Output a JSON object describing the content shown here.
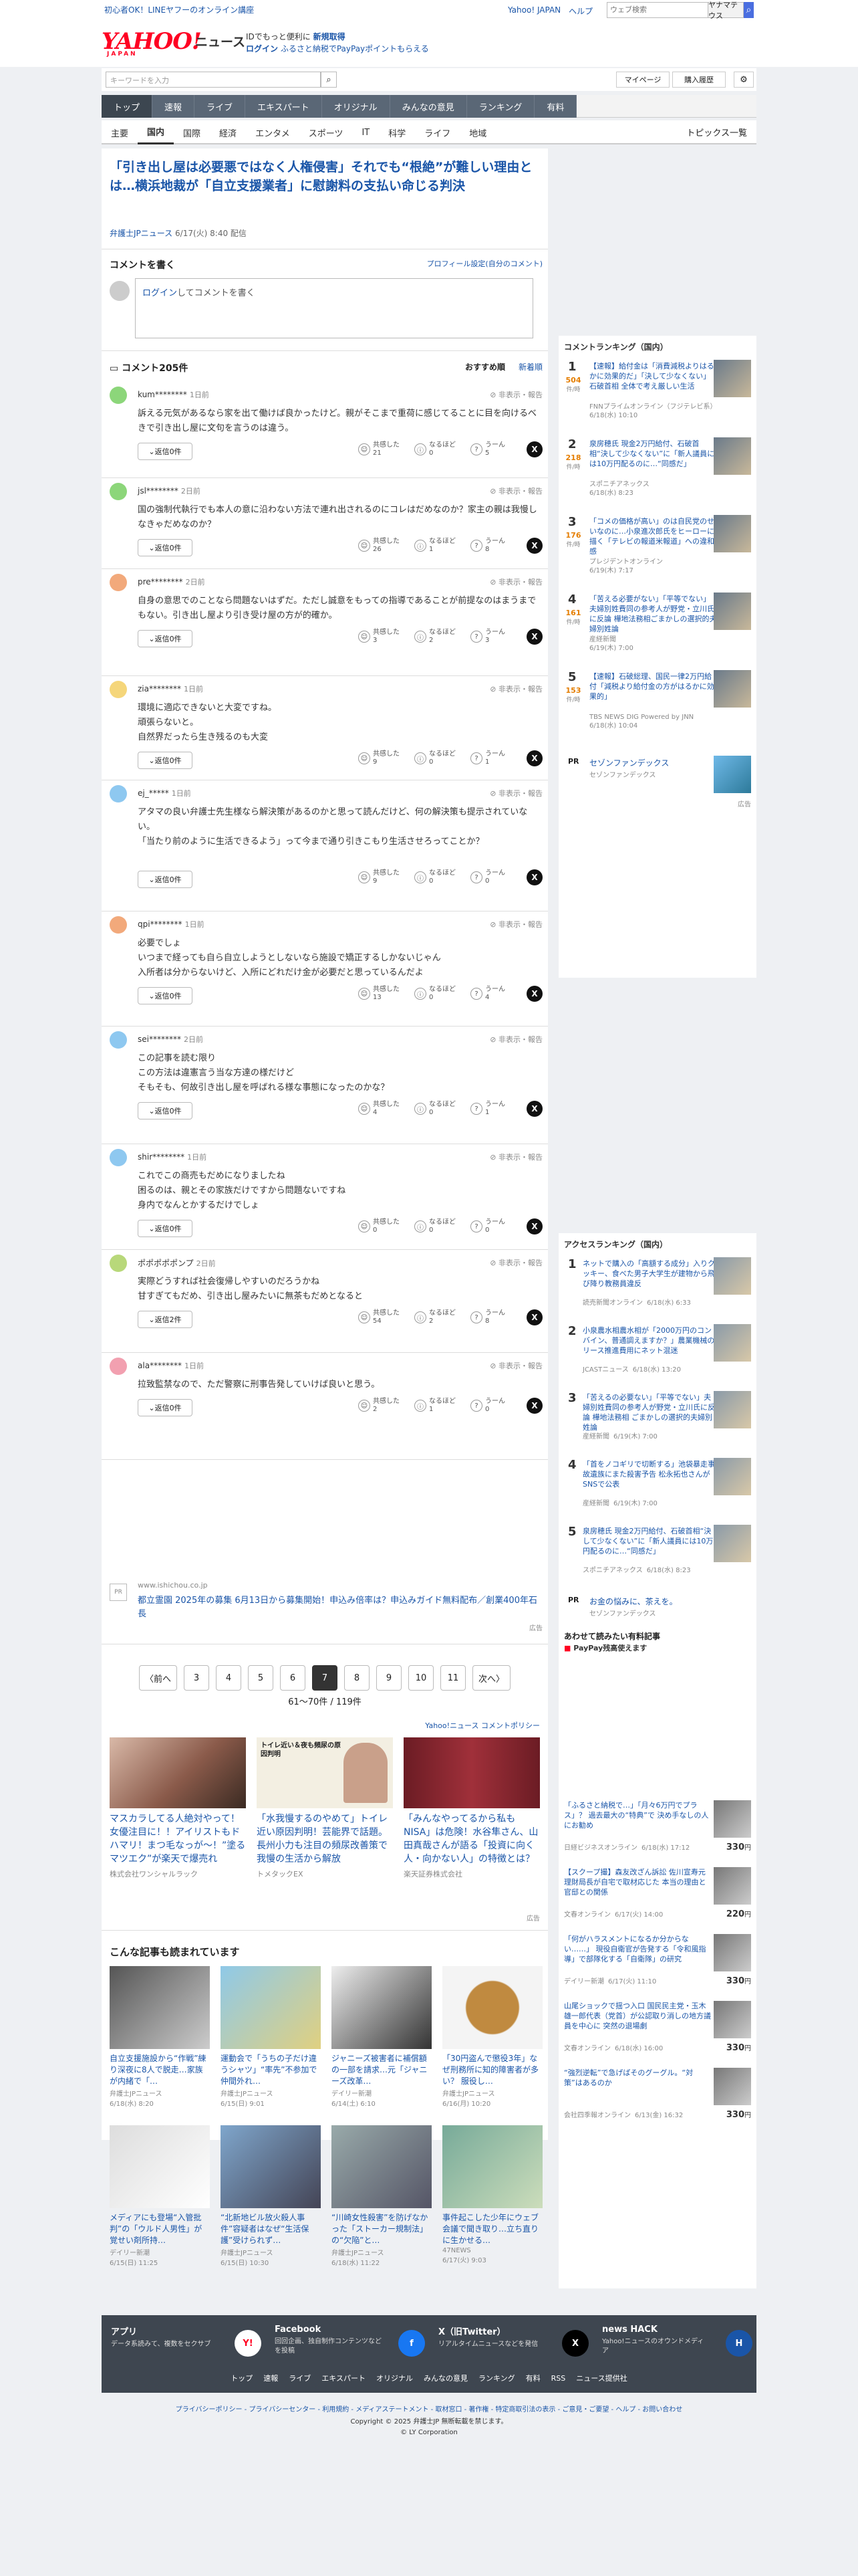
{
  "header": {
    "promo": "初心者OK！LINEヤフーのオンライン講座",
    "links": [
      "Yahoo! JAPAN",
      "ヘルプ"
    ],
    "search_placeholder": "ウェブ検索",
    "search_tab": "ヤナマテウス",
    "logo": "YAHOO!",
    "logo_sub": "JAPAN",
    "service": "ニュース",
    "promo2_a": "IDでもっと便利に",
    "promo2_b": "新規取得",
    "promo2_c": "ログイン",
    "promo2_d": "ふるさと納税でPayPayポイントもらえる"
  },
  "search": {
    "placeholder": "キーワードを入力",
    "mypage": "マイページ",
    "buy": "購入履歴"
  },
  "nav1": [
    "トップ",
    "速報",
    "ライブ",
    "エキスパート",
    "オリジナル",
    "みんなの意見",
    "ランキング",
    "有料"
  ],
  "nav2": [
    "主要",
    "国内",
    "国際",
    "経済",
    "エンタメ",
    "スポーツ",
    "IT",
    "科学",
    "ライフ",
    "地域"
  ],
  "nav2_right": "トピックス一覧",
  "article": {
    "title": "「引き出し屋は必要悪ではなく人権侵害」それでも“根絶”が難しい理由とは…横浜地裁が「自立支援業者」に慰謝料の支払い命じる判決",
    "source": "弁護士JPニュース",
    "date": "6/17(火) 8:40 配信"
  },
  "comment_write": {
    "head": "コメントを書く",
    "setting": "プロフィール設定(自分のコメント)",
    "box_link": "ログイン",
    "box_rest": "してコメントを書く"
  },
  "comments_head": {
    "count": "コメント205件",
    "sort1": "おすすめ順",
    "sort2": "新着順"
  },
  "comment_labels": {
    "report": "非表示・報告",
    "reply": "返信0件",
    "reply2": "返信2件",
    "kyokan": "共感した",
    "naruhodo": "なるほど",
    "un": "うーん"
  },
  "comments": [
    {
      "user": "kum********",
      "time": "1日前",
      "text": "訴える元気があるなら家を出て働けば良かったけど。親がそこまで重荷に感じてることに目を向けるべきで引き出し屋に文句を言うのは違う。",
      "k": "21",
      "n": "0",
      "u": "5",
      "color": "#8cd67a"
    },
    {
      "user": "jsl********",
      "time": "2日前",
      "text": "国の強制代執行でも本人の意に沿わない方法で連れ出されるのにコレはだめなのか？家主の親は我慢しなきゃだめなのか？",
      "k": "26",
      "n": "1",
      "u": "8",
      "color": "#8cd67a"
    },
    {
      "user": "pre********",
      "time": "2日前",
      "text": "自身の意思でのことなら問題ないはずだ。ただし誠意をもっての指導であることが前提なのはまうまでもない。引き出し屋より引き受け屋の方が的確か。",
      "k": "3",
      "n": "2",
      "u": "3",
      "color": "#f2a97b"
    },
    {
      "user": "zia********",
      "time": "1日前",
      "text": "環境に適応できないと大変ですね。\n頑張らないと。\n自然界だったら生き残るのも大変",
      "k": "9",
      "n": "0",
      "u": "1",
      "color": "#f5d67a"
    },
    {
      "user": "ej_*****",
      "time": "1日前",
      "text": "アタマの良い弁護士先生様なら解決策があるのかと思って読んだけど、何の解決策も提示されていない。\n「当たり前のように生活できるよう」って今まで通り引きこもり生活させろってことか？",
      "k": "9",
      "n": "0",
      "u": "0",
      "color": "#8ec8f0"
    },
    {
      "user": "qpi********",
      "time": "1日前",
      "text": "必要でしょ\nいつまで経っても自ら自立しようとしないなら施設で矯正するしかないじゃん\n入所者は分からないけど、入所にどれだけ金が必要だと思っているんだよ",
      "k": "13",
      "n": "0",
      "u": "4",
      "color": "#f2a97b"
    },
    {
      "user": "sei********",
      "time": "2日前",
      "text": "この記事を読む限り\nこの方法は違憲言う当な方達の様だけど\nそもそも、何故引き出し屋を呼ばれる様な事態になったのかな？",
      "k": "4",
      "n": "0",
      "u": "1",
      "color": "#8ec8f0"
    },
    {
      "user": "shir********",
      "time": "1日前",
      "text": "これでこの商売もだめになりましたね\n困るのは、親とその家族だけですから問題ないですね\n身内でなんとかするだけでしょ",
      "k": "0",
      "n": "0",
      "u": "0",
      "color": "#8ec8f0"
    },
    {
      "user": "ポポポポポンプ",
      "time": "2日前",
      "text": "実際どうすれば社会復帰しやすいのだろうかね\n甘すぎてもだめ、引き出し屋みたいに無茶もだめとなると",
      "k": "54",
      "n": "2",
      "u": "8",
      "color": "#b8d87a"
    },
    {
      "user": "ala********",
      "time": "1日前",
      "text": "拉致監禁なので、ただ警察に刑事告発していけば良いと思う。",
      "k": "2",
      "n": "1",
      "u": "0",
      "color": "#f2a0b0"
    }
  ],
  "ad": {
    "url": "www.ishichou.co.jp",
    "text": "都立霊園 2025年の募集 6月13日から募集開始！申込み倍率は？申込みガイド無料配布／創業400年石長",
    "label": "広告"
  },
  "pager": {
    "prev": "〈前へ",
    "pages": [
      "3",
      "4",
      "5",
      "6",
      "7",
      "8",
      "9",
      "10",
      "11"
    ],
    "current": "7",
    "next": "次へ〉",
    "count": "61〜70件 / 119件",
    "policy": "Yahoo!ニュース コメントポリシー"
  },
  "ads3": [
    {
      "title": "マスカラしてる人絶対やって！女優注目に！！アイリストもドハマリ！まつ毛なっが〜！”塗るマツエク”が楽天で爆売れ",
      "sponsor": "株式会社ワンシャルラック"
    },
    {
      "title": "「水我慢するのやめて」トイレ近い原因判明！芸能界で話題。長州小力も注目の頻尿改善策で我慢の生活から解放",
      "sponsor": "トメタックEX",
      "img_text": "トイレ近い＆夜も頻尿の原因判明"
    },
    {
      "title": "「みんなやってるから私もNISA」は危険！水谷隼さん、山田真哉さんが語る「投資に向く人・向かない人」の特徴とは？",
      "sponsor": "楽天証券株式会社"
    }
  ],
  "related_title": "こんな記事も読まれています",
  "related": [
    {
      "title": "自立支援施設から“作戦”練り深夜に8人で脱走…家族が内緒で「…",
      "src": "弁護士JPニュース",
      "date": "6/18(水) 8:20"
    },
    {
      "title": "運動会で「うちの子だけ違うシャツ」“率先”不参加で仲間外れ…",
      "src": "弁護士JPニュース",
      "date": "6/15(日) 9:01"
    },
    {
      "title": "ジャニーズ被害者に補償額の一部を請求…元「ジャニーズ改革…",
      "src": "デイリー新潮",
      "date": "6/14(土) 6:10"
    },
    {
      "title": "「30円盗んで懲役3年」なぜ刑務所に知的障害者が多い？ 服役し…",
      "src": "弁護士JPニュース",
      "date": "6/16(月) 10:20"
    },
    {
      "title": "メディアにも登場“入管批判”の「ウルド人男性」が覚せい剤所持…",
      "src": "デイリー新潮",
      "date": "6/15(日) 11:25"
    },
    {
      "title": "“北新地ビル放火殺人事件”容疑者はなぜ“生活保護”受けられず…",
      "src": "弁護士JPニュース",
      "date": "6/15(日) 10:30"
    },
    {
      "title": "“川崎女性殺害”を防げなかった「ストーカー規制法」の“欠陥”と…",
      "src": "弁護士JPニュース",
      "date": "6/18(水) 11:22"
    },
    {
      "title": "事件起こした少年にウェブ会議で聞き取り…立ち直りに生かせる…",
      "src": "47NEWS",
      "date": "6/17(火) 9:03"
    }
  ],
  "ranking": {
    "title": "コメントランキング（国内）",
    "items": [
      {
        "n": "1",
        "c": "504",
        "t": "【速報】給付金は「消費減税よりはるかに効果的だ」「決して少なくない」石破首相 全体で考え厳しい生活",
        "s": "FNNプライムオンライン（フジテレビ系）",
        "d": "6/18(水) 10:10"
      },
      {
        "n": "2",
        "c": "218",
        "t": "泉房穂氏 現金2万円給付、石破首相“決して少なくない”に「新人議員には10万円配るのに…“同感だ」",
        "s": "スポニチアネックス",
        "d": "6/18(水) 8:23"
      },
      {
        "n": "3",
        "c": "176",
        "t": "「コメの価格が高い」のは自民党のせいなのに…小泉進次郎氏をヒーローに描く「テレビの報道米報道」への違和感",
        "s": "プレジデントオンライン",
        "d": "6/19(木) 7:17"
      },
      {
        "n": "4",
        "c": "161",
        "t": "「苦える必要がない」「平等でない」夫婦別姓費同の参考人が野党・立川氏に反論 樺地法務相ごまかしの選択的夫婦別姓論",
        "s": "産経新聞",
        "d": "6/19(木) 7:00"
      },
      {
        "n": "5",
        "c": "153",
        "t": "【速報】石破総理、国民一律2万円給付「減税より給付金の方がはるかに効果的」",
        "s": "TBS NEWS DIG Powered by JNN",
        "d": "6/18(水) 10:04"
      }
    ],
    "cnt_unit": "件/時",
    "pr_tag": "PR",
    "pr_title": "セゾンファンデックス",
    "pr_sponsor": "セゾンファンデックス",
    "ad_label": "広告"
  },
  "access": {
    "title": "アクセスランキング（国内）",
    "items": [
      {
        "n": "1",
        "t": "ネットで購入の「高額する成分」入りクッキー、食べた男子大学生が建物から飛び降り教務員違反",
        "s": "読売新聞オンライン",
        "d": "6/18(水) 6:33"
      },
      {
        "n": "2",
        "t": "小泉農水相農水相が「2000万円のコンバイン、普通調えますか？」農業機械のリース推進費用にネット混迷",
        "s": "JCASTニュース",
        "d": "6/18(水) 13:20"
      },
      {
        "n": "3",
        "t": "「苦えるの必要ない」「平等でない」夫婦別姓費同の参考人が野党・立川氏に反論 樺地法務相 ごまかしの選択的夫婦別姓論",
        "s": "産経新聞",
        "d": "6/19(木) 7:00"
      },
      {
        "n": "4",
        "t": "「首をノコギリで切断する」池袋暴走事故遺族にまた殺害予告 松永拓也さんがSNSで公表",
        "s": "産経新聞",
        "d": "6/19(木) 7:00"
      },
      {
        "n": "5",
        "t": "泉房穂氏 現金2万円給付、石破首相“決して少なくない”に「新人議員には10万円配るのに…“同感だ」",
        "s": "スポニチアネックス",
        "d": "6/18(水) 8:23"
      }
    ],
    "pr_title": "お金の悩みに、茶えを。",
    "pr_sponsor": "セゾンファンデックス"
  },
  "paid": {
    "title": "あわせて読みたい有料記事",
    "logo": "PayPay残高使えます",
    "items": [
      {
        "t": "「ふるさと納税で…」「月々6万円でプラス」？ 過去最大の“特典”で 決め手なしの人にお勧め",
        "s": "日経ビジネスオンライン",
        "d": "6/18(水) 17:12",
        "p": "330"
      },
      {
        "t": "【スクープ撮】森友改ざん訴訟 佐川宣寿元理財局長が自宅で取材応じた 本当の理由と官邸との関係",
        "s": "文春オンライン",
        "d": "6/17(火) 14:00",
        "p": "220"
      },
      {
        "t": "「何がハラスメントになるか分からない……」 現役自衛官が告発する「令和風指導」で部隊化する「自衛隊」の研究",
        "s": "デイリー新潮",
        "d": "6/17(火) 11:10",
        "p": "330"
      },
      {
        "t": "山尾ショックで揺つ入口 国民民主党・玉木雄一郎代表（党首）が公認取り消しの地方議員を中心に 突然の退場劇",
        "s": "文春オンライン",
        "d": "6/18(水) 16:00",
        "p": "330"
      },
      {
        "t": "“強烈逆転”で急げばそのグーグル。“対策”はあるのか",
        "s": "会社四季報オンライン",
        "d": "6/13(金) 16:32",
        "p": "330"
      }
    ],
    "yen": "円"
  },
  "footer": {
    "cols": [
      {
        "h": "アプリ",
        "d": "データ系読みて、複数をセクサブ",
        "icon": "Y!"
      },
      {
        "h": "Facebook",
        "d": "回回企画、独自制作コンテンツなどを投稿",
        "icon": "f"
      },
      {
        "h": "X（旧Twitter）",
        "d": "リアルタイムニュースなどを発信",
        "icon": "X"
      },
      {
        "h": "news HACK",
        "d": "Yahoo!ニュースのオウンドメディア",
        "icon": "H"
      }
    ],
    "nav": [
      "トップ",
      "速報",
      "ライブ",
      "エキスパート",
      "オリジナル",
      "みんなの意見",
      "ランキング",
      "有料",
      "RSS",
      "ニュース提供社"
    ],
    "legal": "プライバシーポリシー - プライバシーセンター - 利用規約 - メディアステートメント - 取材窓口 - 著作権 - 特定商取引法の表示 - ご意見・ご要望 - ヘルプ - お問い合わせ",
    "copy1": "Copyright © 2025 弁護士JP 無断転載を禁じます。",
    "copy2": "© LY Corporation"
  },
  "colors": {
    "accent": "#1a55a8",
    "nav": "#5a6776",
    "rankcount": "#e57e00"
  }
}
